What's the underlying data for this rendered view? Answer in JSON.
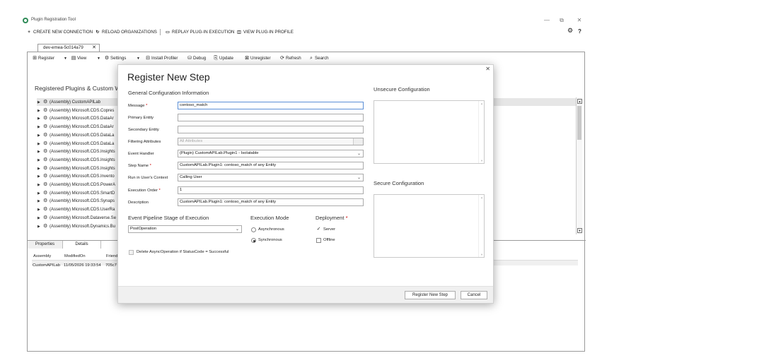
{
  "window": {
    "title": "Plugin Registration Tool",
    "min": "—",
    "restore": "⧉",
    "close": "✕"
  },
  "menu": {
    "create_connection": "CREATE NEW CONNECTION",
    "reload_orgs": "RELOAD ORGANIZATIONS",
    "replay": "REPLAY PLUG-IN EXECUTION",
    "view_profile": "VIEW PLUG-IN PROFILE"
  },
  "connection_tab": {
    "label": "dev-emea-5c014a79",
    "close": "✕"
  },
  "toolbar": {
    "register": "Register",
    "view": "View",
    "settings": "Settings",
    "install_profiler": "Install Profiler",
    "debug": "Debug",
    "update": "Update",
    "unregister": "Unregister",
    "refresh": "Refresh",
    "search": "Search"
  },
  "tree": {
    "title": "Registered Plugins & Custom Wor",
    "items": [
      "(Assembly) CustomAPILab",
      "(Assembly) Microsoft.CDS.Copres",
      "(Assembly) Microsoft.CDS.DataAr",
      "(Assembly) Microsoft.CDS.DataAr",
      "(Assembly) Microsoft.CDS.DataLa",
      "(Assembly) Microsoft.CDS.DataLa",
      "(Assembly) Microsoft.CDS.Insights",
      "(Assembly) Microsoft.CDS.Insights",
      "(Assembly) Microsoft.CDS.Insights",
      "(Assembly) Microsoft.CDS.Invento",
      "(Assembly) Microsoft.CDS.PowerA",
      "(Assembly) Microsoft.CDS.SmartD",
      "(Assembly) Microsoft.CDS.Synaps",
      "(Assembly) Microsoft.CDS.UserRa",
      "(Assembly) Microsoft.Dataverse.Se",
      "(Assembly) Microsoft.Dynamics.Bu",
      "(Assembly) Microsoft.Dynamics.Cu"
    ]
  },
  "bottom_tabs": {
    "properties": "Properties",
    "details": "Details"
  },
  "details": {
    "headers": [
      "Assembly",
      "ModifiedOn",
      "Friend"
    ],
    "row": [
      "CustomAPILab",
      "11/05/2026 19:33:54",
      "705c7"
    ]
  },
  "dialog": {
    "title": "Register New Step",
    "close": "✕",
    "general_heading": "General Configuration Information",
    "unsecure_heading": "Unsecure  Configuration",
    "secure_heading": "Secure  Configuration",
    "fields": {
      "message": {
        "label": "Message",
        "value": "contoso_match"
      },
      "primary_entity": {
        "label": "Primary Entity",
        "value": ""
      },
      "secondary_entity": {
        "label": "Secondary Entity",
        "value": ""
      },
      "filtering_attributes": {
        "label": "Filtering Attributes",
        "placeholder": "All Attributes"
      },
      "event_handler": {
        "label": "Event Handler",
        "value": "(Plugin) CustomAPILab.Plugin1 - Isolatable"
      },
      "step_name": {
        "label": "Step Name",
        "value": "CustomAPILab.Plugin1: contoso_match of any Entity"
      },
      "run_context": {
        "label": "Run in User's Context",
        "value": "Calling User"
      },
      "execution_order": {
        "label": "Execution Order",
        "value": "1"
      },
      "description": {
        "label": "Description",
        "value": "CustomAPILab.Plugin1: contoso_match of any Entity"
      }
    },
    "required_marker": "*",
    "pipeline": {
      "heading": "Event Pipeline Stage of Execution",
      "value": "PostOperation"
    },
    "execution_mode": {
      "heading": "Execution Mode",
      "async": "Asynchronous",
      "sync": "Synchronous",
      "selected": "Synchronous"
    },
    "deployment": {
      "heading": "Deployment",
      "server": "Server",
      "offline": "Offline",
      "server_checked": true,
      "offline_checked": false
    },
    "delete_async": "Delete AsyncOperation if StatusCode = Successful",
    "register_button": "Register New Step",
    "cancel_button": "Cancel"
  },
  "colors": {
    "accent_blue": "#5b8fd6",
    "required_red": "#cc0000",
    "footer_bg": "#f0f0f0"
  }
}
